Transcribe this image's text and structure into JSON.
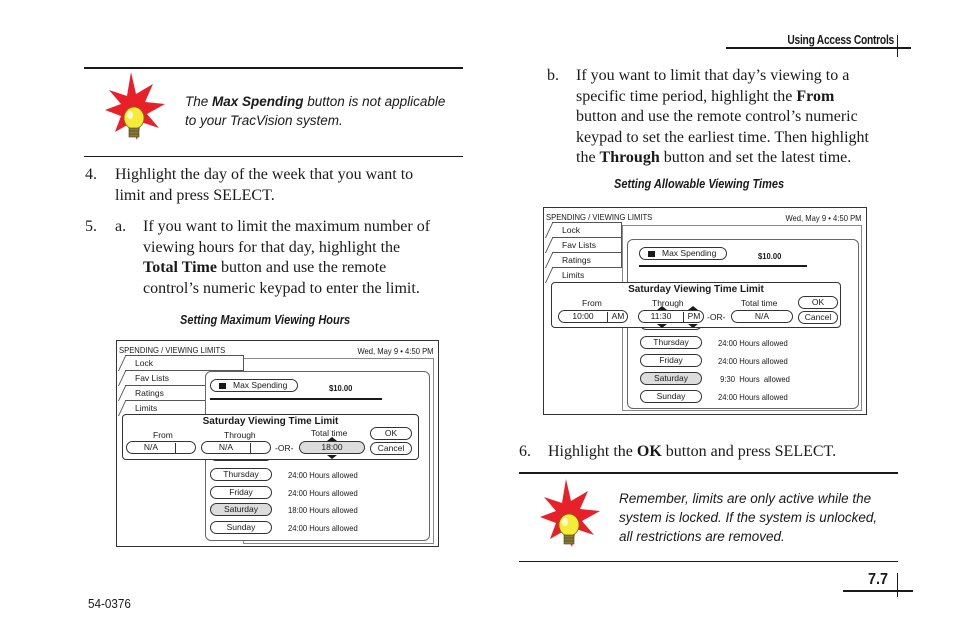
{
  "header": {
    "running_head": "Using Access Controls"
  },
  "notes": {
    "top": {
      "icon": "lightbulb-burst-icon",
      "pre": "The ",
      "bold": "Max Spending",
      "post": " button is not applicable",
      "line2": "to your TracVision system."
    },
    "bottom": {
      "icon": "lightbulb-burst-icon",
      "line1": "Remember, limits are only active while the",
      "line2": "system is locked. If the system is unlocked,",
      "line3": "all restrictions are removed."
    }
  },
  "steps": {
    "step4": {
      "num": "4.",
      "line1": "Highlight the day of the week that you want to",
      "line2": "limit and press SELECT."
    },
    "step5": {
      "num": "5.",
      "sub": "a.",
      "line1": "If you want to limit the maximum number of",
      "line2": "viewing hours for that day, highlight the",
      "line3_bold": "Total Time",
      "line3_rest": " button and use the remote",
      "line4": "control’s numeric keypad to enter the limit."
    },
    "step5b": {
      "sub": "b.",
      "line1": "If you want to limit that day’s viewing to a",
      "line2_pre": "specific time period, highlight the ",
      "line2_bold": "From",
      "line3": "button and use the remote control’s numeric",
      "line4": "keypad to set the earliest time. Then highlight",
      "line5_pre": "the ",
      "line5_bold": "Through",
      "line5_post": " button and set the latest time."
    },
    "step6": {
      "num": "6.",
      "pre": "Highlight the ",
      "bold": "OK",
      "post": " button and press SELECT."
    }
  },
  "figures": {
    "left": {
      "caption": "Setting Maximum Viewing Hours",
      "title": "SPENDING / VIEWING LIMITS",
      "date": "Wed, May 9  •  4:50 PM",
      "tabs": [
        "Lock",
        "Fav Lists",
        "Ratings",
        "Limits"
      ],
      "max_spending_label": "Max Spending",
      "max_spending_value": "$10.00",
      "dialog": {
        "title": "Saturday Viewing Time Limit",
        "from_label": "From",
        "through_label": "Through",
        "total_label": "Total time",
        "from_value": "N/A",
        "from_ampm": "",
        "through_value": "N/A",
        "through_ampm": "",
        "or": "-OR-",
        "total_value": "18:00",
        "ok": "OK",
        "cancel": "Cancel"
      },
      "days": [
        {
          "day": "Thursday",
          "hours": "24:00  Hours  allowed"
        },
        {
          "day": "Friday",
          "hours": "24:00  Hours  allowed"
        },
        {
          "day": "Saturday",
          "hours": "18:00  Hours  allowed"
        },
        {
          "day": "Sunday",
          "hours": "24:00  Hours  allowed"
        }
      ]
    },
    "right": {
      "caption": "Setting Allowable Viewing Times",
      "title": "SPENDING / VIEWING LIMITS",
      "date": "Wed, May 9  •  4:50 PM",
      "tabs": [
        "Lock",
        "Fav Lists",
        "Ratings",
        "Limits"
      ],
      "max_spending_label": "Max Spending",
      "max_spending_value": "$10.00",
      "dialog": {
        "title": "Saturday Viewing Time Limit",
        "from_label": "From",
        "through_label": "Through",
        "total_label": "Total time",
        "from_value": "10:00",
        "from_ampm": "AM",
        "through_value": "11:30",
        "through_ampm": "PM",
        "or": "-OR-",
        "total_value": "N/A",
        "ok": "OK",
        "cancel": "Cancel"
      },
      "days": [
        {
          "day": "Thursday",
          "hours": "24:00  Hours  allowed"
        },
        {
          "day": "Friday",
          "hours": "24:00  Hours  allowed"
        },
        {
          "day": "Saturday",
          "hours": " 9:30  Hours  allowed"
        },
        {
          "day": "Sunday",
          "hours": "24:00  Hours  allowed"
        }
      ]
    }
  },
  "footer": {
    "doc_number": "54-0376",
    "page_number": "7.7"
  },
  "colors": {
    "burst_red": "#e8202a",
    "bulb_yellow": "#f5ec3a",
    "selected_gray": "#dcdcdc"
  }
}
